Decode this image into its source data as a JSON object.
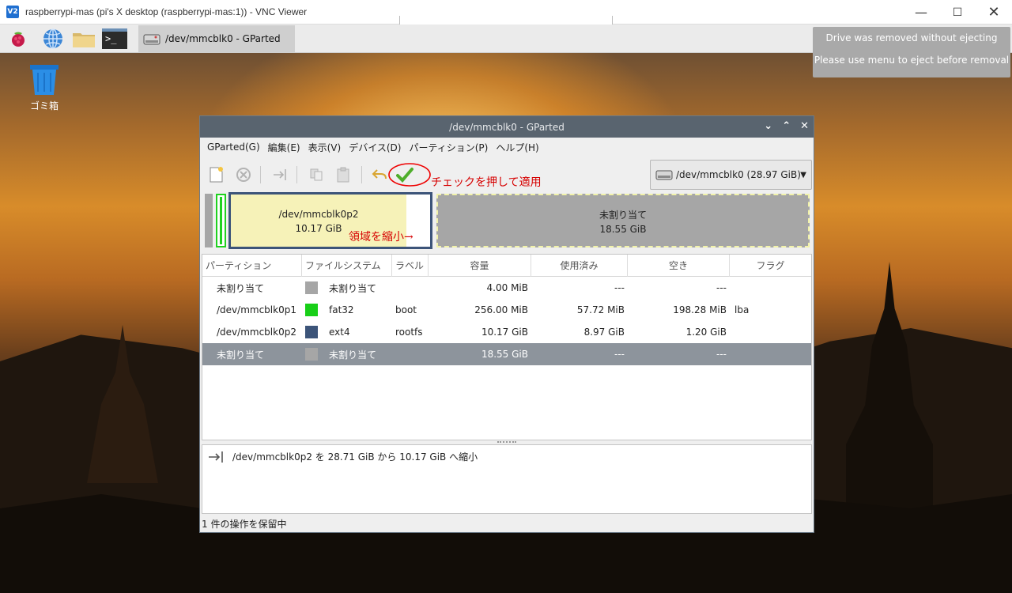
{
  "vnc": {
    "logo": "V2",
    "title": "raspberrypi-mas (pi's X desktop (raspberrypi-mas:1)) - VNC Viewer"
  },
  "panel": {
    "task_label": "/dev/mmcblk0 - GParted",
    "icons": [
      "raspberry-menu-icon",
      "web-browser-icon",
      "file-manager-icon",
      "terminal-icon"
    ],
    "terminal_glyph": ">_"
  },
  "notification": {
    "line1": "Drive was removed without ejecting",
    "line2": "Please use menu to eject before removal"
  },
  "desktop": {
    "trash_label": "ゴミ箱"
  },
  "gparted": {
    "title": "/dev/mmcblk0 - GParted",
    "title_controls": [
      "⌄",
      "⌃",
      "✕"
    ],
    "menu": [
      "GParted(G)",
      "編集(E)",
      "表示(V)",
      "デバイス(D)",
      "パーティション(P)",
      "ヘルプ(H)"
    ],
    "device_combo": "/dev/mmcblk0   (28.97 GiB)",
    "annotations": {
      "apply_hint": "チェックを押して適用",
      "shrink_hint": "領域を縮小→"
    },
    "map": {
      "root_name": "/dev/mmcblk0p2",
      "root_size": "10.17 GiB",
      "free_name": "未割り当て",
      "free_size": "18.55 GiB"
    },
    "columns": [
      "パーティション",
      "ファイルシステム",
      "ラベル",
      "容量",
      "使用済み",
      "空き",
      "フラグ"
    ],
    "rows": [
      {
        "partition": "未割り当て",
        "fs": "未割り当て",
        "color": "#a6a6a6",
        "label": "",
        "size": "4.00 MiB",
        "used": "---",
        "free": "---",
        "flags": ""
      },
      {
        "partition": "/dev/mmcblk0p1",
        "fs": "fat32",
        "color": "#18cf18",
        "label": "boot",
        "size": "256.00 MiB",
        "used": "57.72 MiB",
        "free": "198.28 MiB",
        "flags": "lba"
      },
      {
        "partition": "/dev/mmcblk0p2",
        "fs": "ext4",
        "color": "#3c5479",
        "label": "rootfs",
        "size": "10.17 GiB",
        "used": "8.97 GiB",
        "free": "1.20 GiB",
        "flags": ""
      },
      {
        "partition": "未割り当て",
        "fs": "未割り当て",
        "color": "#a6a6a6",
        "label": "",
        "size": "18.55 GiB",
        "used": "---",
        "free": "---",
        "flags": ""
      }
    ],
    "selected_row": 3,
    "pending_op": "/dev/mmcblk0p2 を 28.71 GiB から 10.17 GiB へ縮小",
    "status": "1 件の操作を保留中"
  }
}
